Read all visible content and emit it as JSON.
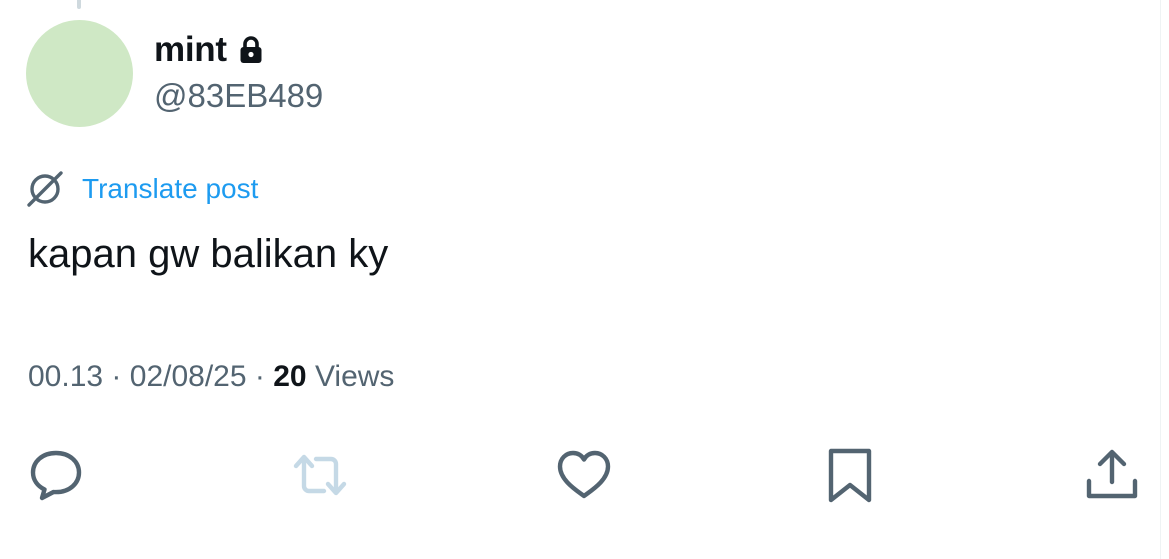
{
  "post": {
    "author": {
      "display_name": "mint",
      "handle": "@83EB489",
      "avatar_color": "#cfe8c5",
      "protected_icon": "lock-icon"
    },
    "translate_label": "Translate post",
    "text": "kapan gw balikan ky",
    "time": "00.13",
    "date": "02/08/25",
    "separator": "·",
    "views_count": "20",
    "views_label": "Views"
  },
  "actions": {
    "reply_icon": "reply-icon",
    "repost_icon": "repost-icon",
    "like_icon": "heart-icon",
    "bookmark_icon": "bookmark-icon",
    "share_icon": "share-icon"
  },
  "colors": {
    "text_primary": "#0f1419",
    "text_secondary": "#536471",
    "link": "#1d9bf0",
    "icon": "#536471",
    "repost_disabled": "#c5d9e6"
  }
}
